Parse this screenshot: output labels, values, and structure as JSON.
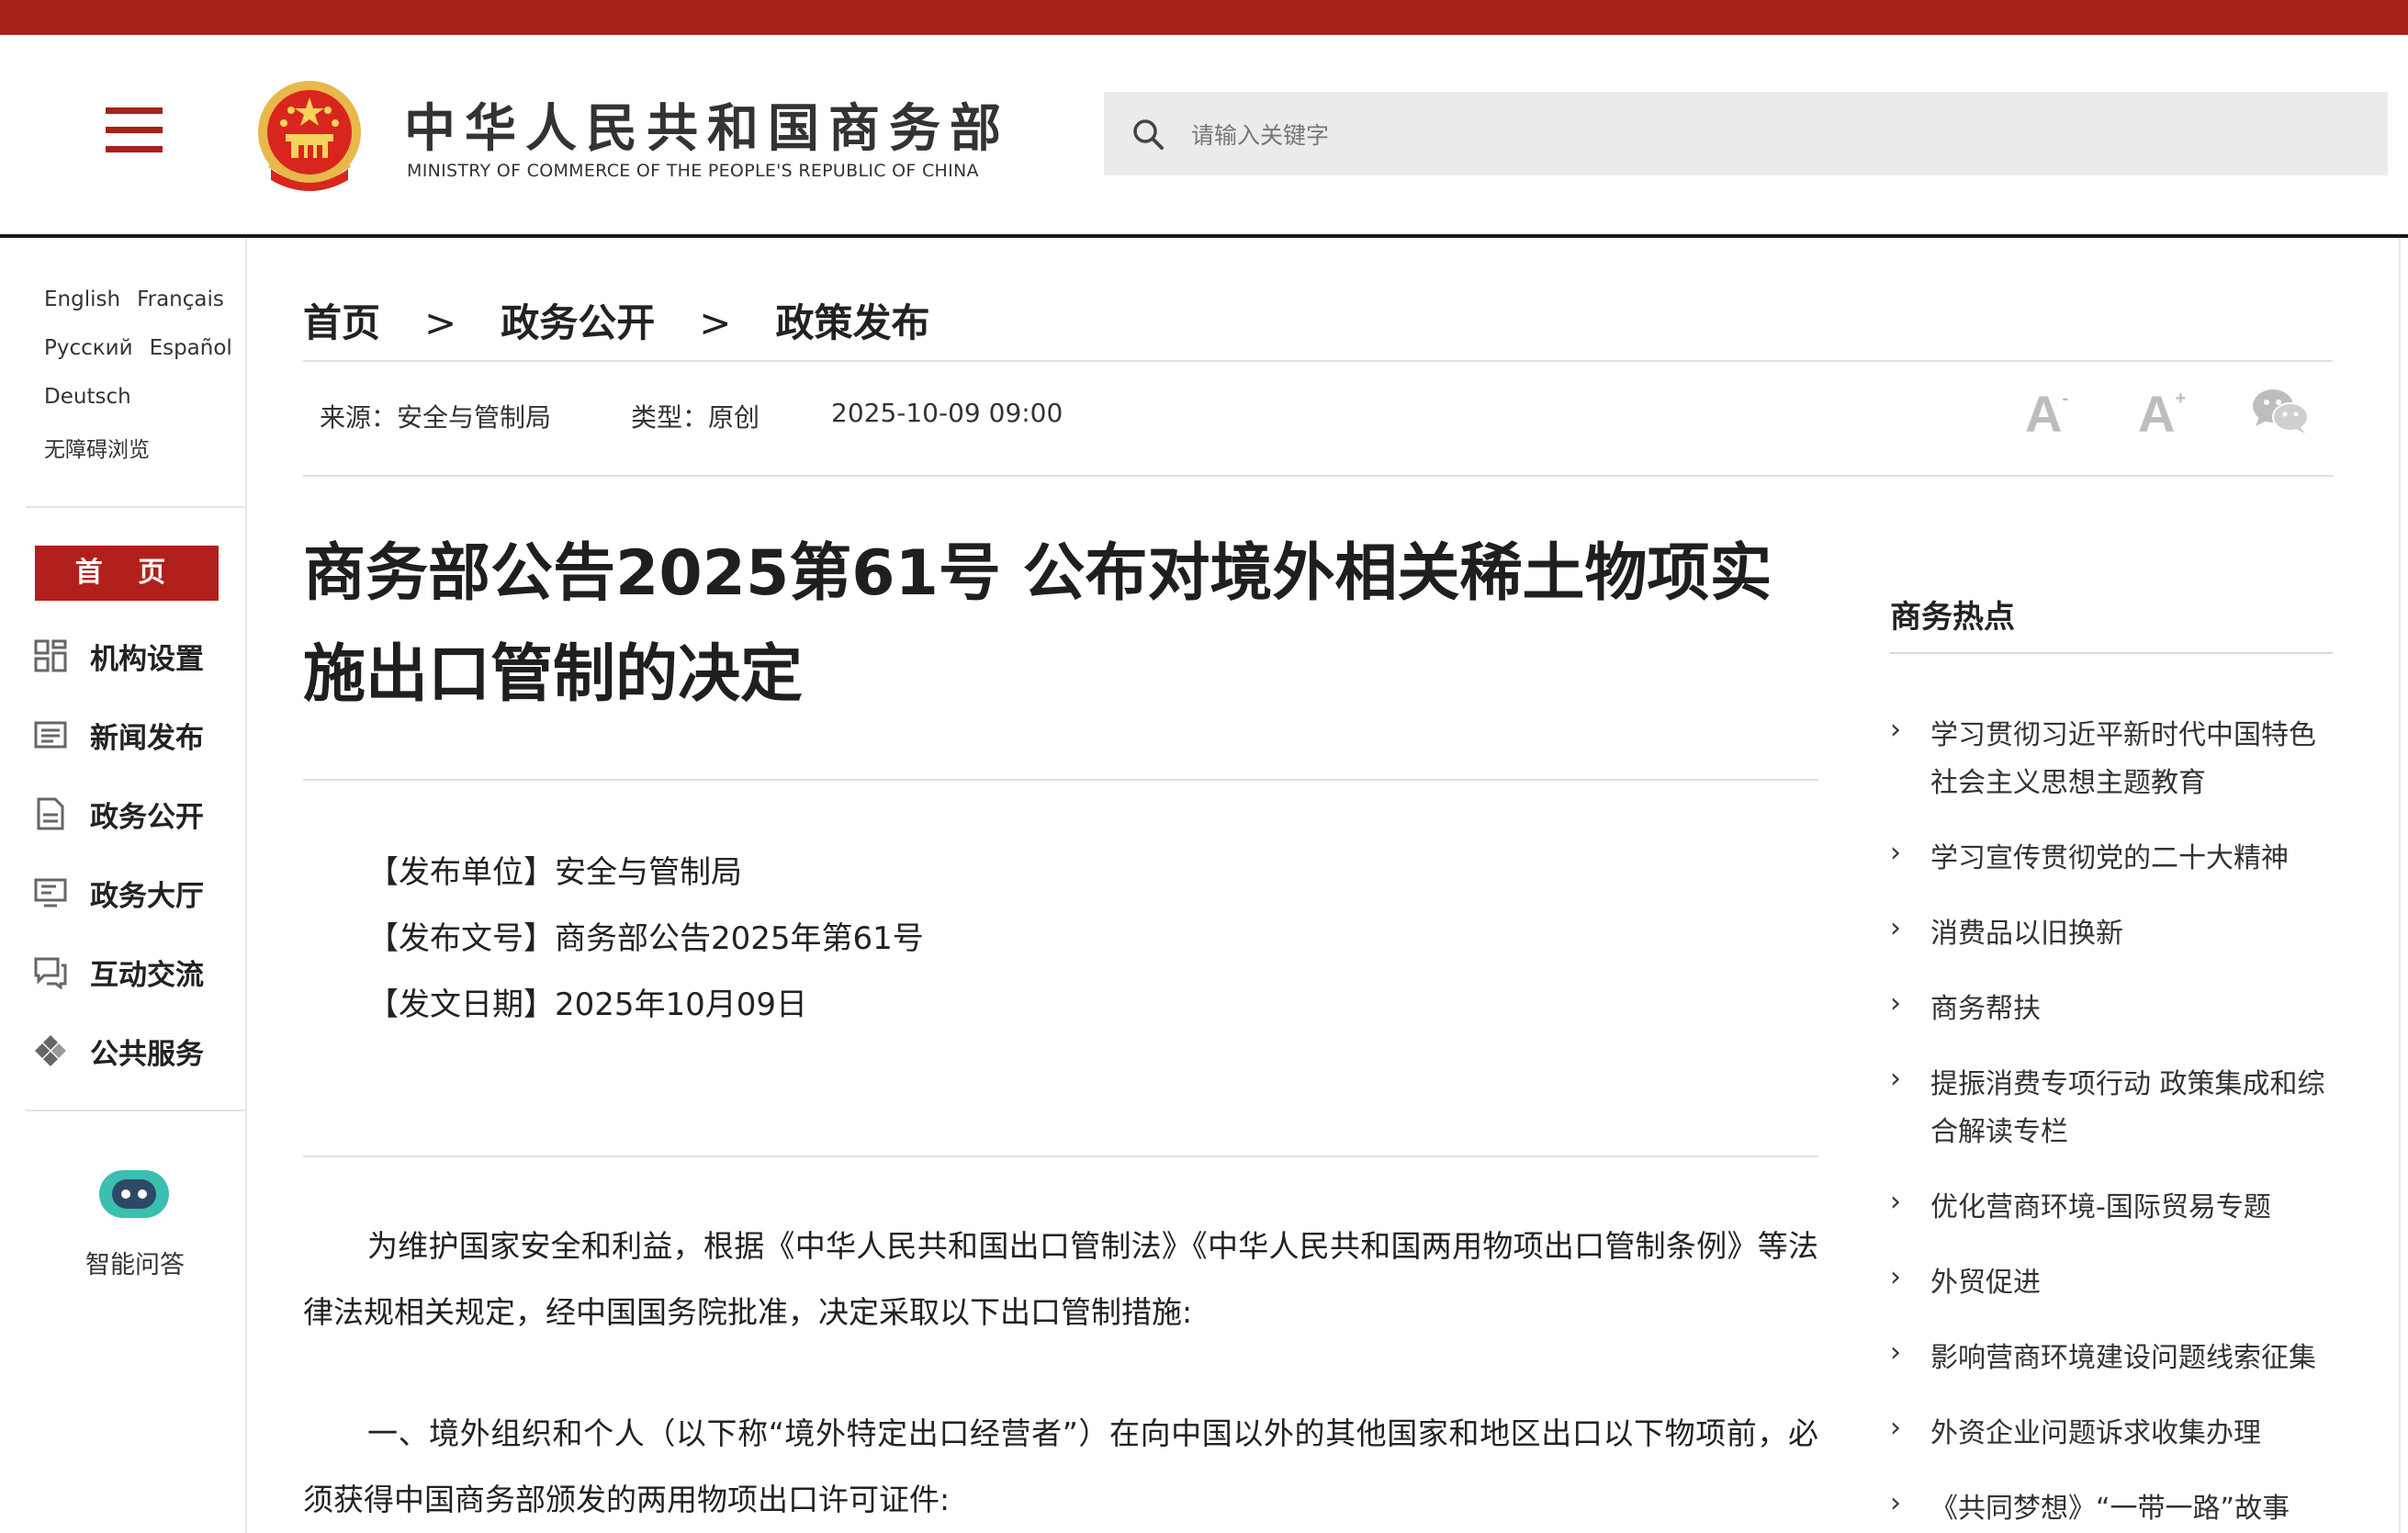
{
  "header": {
    "site_title": "中华人民共和国商务部",
    "site_subtitle": "MINISTRY OF COMMERCE OF THE PEOPLE'S REPUBLIC OF CHINA",
    "search_placeholder": "请输入关键字"
  },
  "languages": [
    [
      "English",
      "Français"
    ],
    [
      "Русский",
      "Español"
    ],
    [
      "Deutsch"
    ],
    [
      "无障碍浏览"
    ]
  ],
  "nav": {
    "home": "首 页",
    "items": [
      "机构设置",
      "新闻发布",
      "政务公开",
      "政务大厅",
      "互动交流",
      "公共服务"
    ]
  },
  "assistant": {
    "label": "智能问答"
  },
  "breadcrumb": [
    "首页",
    "政务公开",
    "政策发布"
  ],
  "breadcrumb_sep": ">",
  "meta": {
    "source": "来源：安全与管制局",
    "type": "类型：原创",
    "datetime": "2025-10-09 09:00"
  },
  "tools": {
    "font_small": "A",
    "font_large": "A",
    "minus": "-",
    "plus": "+"
  },
  "article": {
    "title": "商务部公告2025第61号 公布对境外相关稀土物项实施出口管制的决定",
    "info": [
      "【发布单位】安全与管制局",
      "【发布文号】商务部公告2025年第61号",
      "【发文日期】2025年10月09日"
    ],
    "paragraphs": [
      "为维护国家安全和利益，根据《中华人民共和国出口管制法》《中华人民共和国两用物项出口管制条例》等法律法规相关规定，经中国国务院批准，决定采取以下出口管制措施:",
      "一、境外组织和个人（以下称“境外特定出口经营者”）在向中国以外的其他国家和地区出口以下物项前，必须获得中国商务部颁发的两用物项出口许可证件:"
    ]
  },
  "sidebar": {
    "title": "商务热点",
    "items": [
      "学习贯彻习近平新时代中国特色社会主义思想主题教育",
      "学习宣传贯彻党的二十大精神",
      "消费品以旧换新",
      "商务帮扶",
      "提振消费专项行动 政策集成和综合解读专栏",
      "优化营商环境-国际贸易专题",
      "外贸促进",
      "影响营商环境建设问题线索征集",
      "外资企业问题诉求收集办理",
      "《共同梦想》“一带一路”故事"
    ]
  },
  "colors": {
    "brand_red": "#a8201a",
    "home_red": "#b1201c",
    "bot_teal": "#3bbfb0"
  }
}
